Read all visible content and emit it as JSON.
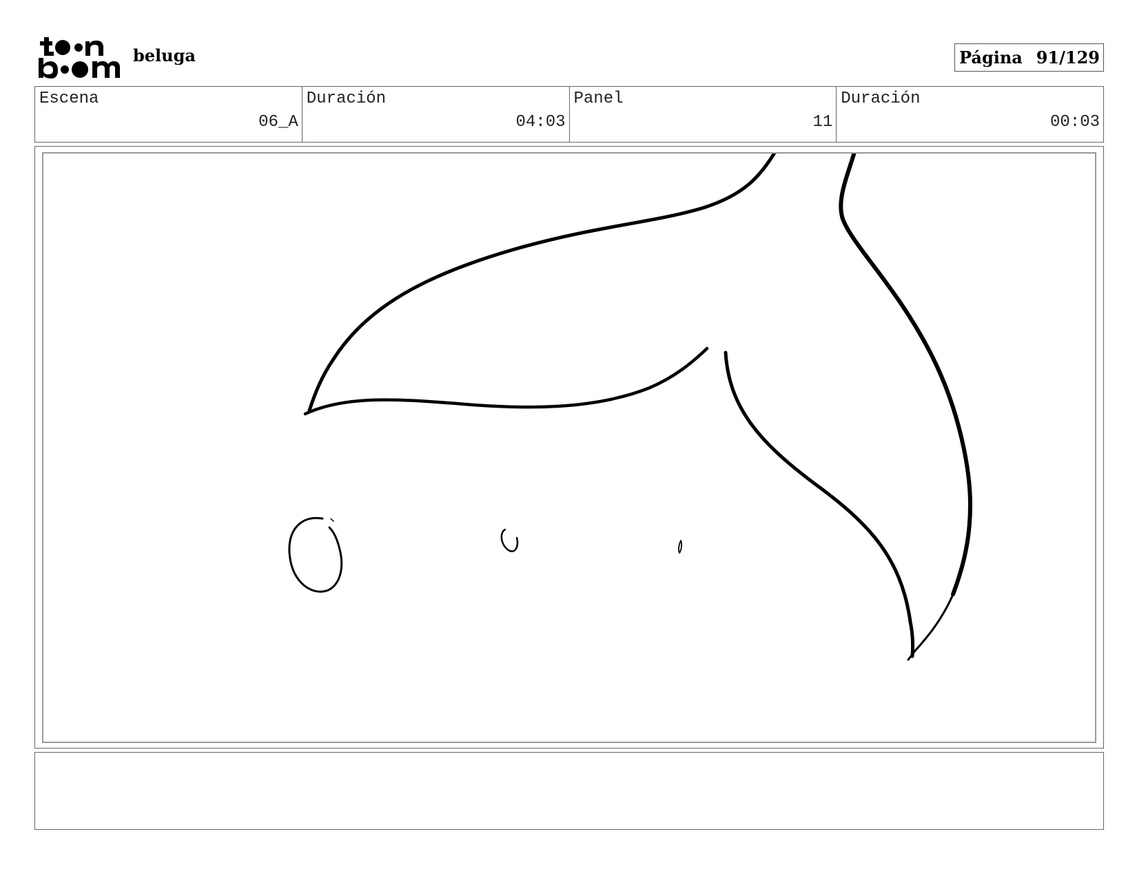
{
  "header": {
    "logo_text": "toon boom",
    "project_title": "beluga",
    "page_label": "Página",
    "page_number": "91/129"
  },
  "info": {
    "scene_label": "Escena",
    "scene_value": "06_A",
    "scene_duration_label": "Duración",
    "scene_duration_value": "04:03",
    "panel_label": "Panel",
    "panel_value": "11",
    "panel_duration_label": "Duración",
    "panel_duration_value": "00:03"
  },
  "drawing": {
    "subject": "whale-tail-with-bubbles",
    "stroke_color": "#000000"
  },
  "notes": {
    "text": ""
  }
}
